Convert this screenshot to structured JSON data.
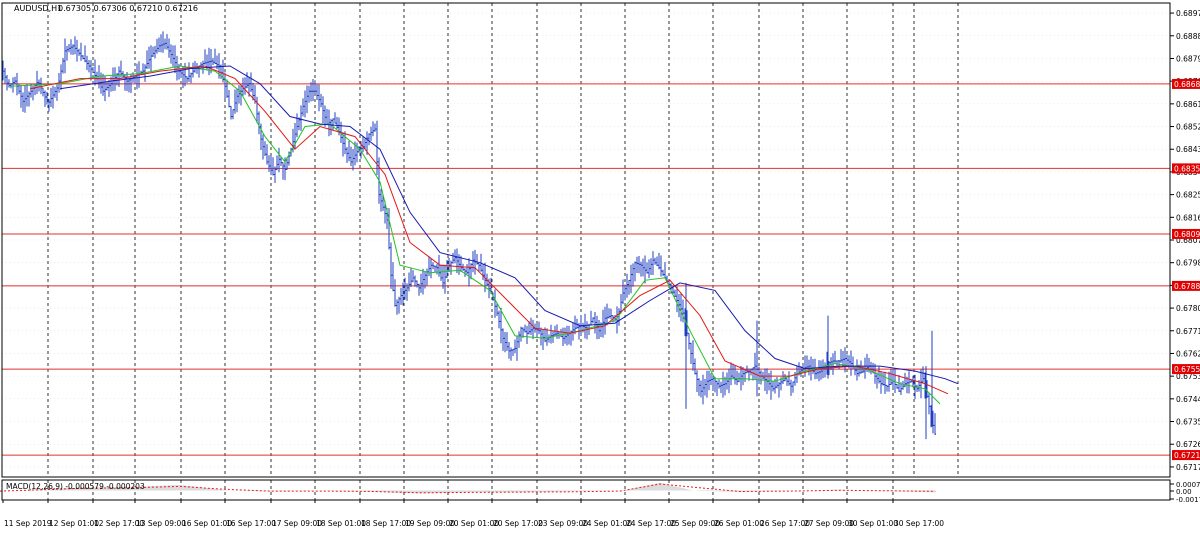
{
  "header": {
    "symbol_label": "AUDUSD,H1",
    "ohlc_text": "0.67305 0.67306 0.67210 0.67216"
  },
  "macd": {
    "label": "MACD(12,26,9) -0.000579 -0.000203",
    "ticks": [
      "0.000786",
      "0.00",
      "-0.00171"
    ]
  },
  "colors": {
    "background": "#ffffff",
    "price": "#1f3fbf",
    "ma_fast": "#22c322",
    "ma_mid": "#e01818",
    "ma_slow": "#1a1ab0",
    "level_line": "#e03030",
    "level_badge": "#e00000",
    "grid": "#000000",
    "macd_hist": "#b8b8b8",
    "macd_signal": "#e02020"
  },
  "chart_data": {
    "type": "candlestick",
    "ylim": [
      0.6713,
      0.6901
    ],
    "y_ticks": [
      "0.68970",
      "0.68880",
      "0.68790",
      "0.68700",
      "0.68610",
      "0.68520",
      "0.68430",
      "0.68340",
      "0.68250",
      "0.68160",
      "0.68070",
      "0.67980",
      "0.67890",
      "0.67800",
      "0.67710",
      "0.67620",
      "0.67530",
      "0.67440",
      "0.67350",
      "0.67260",
      "0.67170"
    ],
    "x_ticks": [
      "11 Sep 2019",
      "12 Sep 01:00",
      "12 Sep 17:00",
      "13 Sep 09:00",
      "16 Sep 01:00",
      "16 Sep 17:00",
      "17 Sep 09:00",
      "18 Sep 01:00",
      "18 Sep 17:00",
      "19 Sep 09:00",
      "20 Sep 01:00",
      "20 Sep 17:00",
      "23 Sep 09:00",
      "24 Sep 01:00",
      "24 Sep 17:00",
      "25 Sep 09:00",
      "26 Sep 01:00",
      "26 Sep 17:00",
      "27 Sep 09:00",
      "30 Sep 01:00",
      "30 Sep 17:00"
    ],
    "horizontal_levels": [
      "0.68689",
      "0.68354",
      "0.68094",
      "0.67888",
      "0.67558",
      "0.67217"
    ],
    "close_path": [
      [
        0,
        0.6874
      ],
      [
        5,
        0.6868
      ],
      [
        12,
        0.687
      ],
      [
        20,
        0.6862
      ],
      [
        28,
        0.6866
      ],
      [
        35,
        0.687
      ],
      [
        45,
        0.6861
      ],
      [
        55,
        0.6868
      ],
      [
        62,
        0.6882
      ],
      [
        70,
        0.6884
      ],
      [
        78,
        0.688
      ],
      [
        86,
        0.6876
      ],
      [
        94,
        0.6871
      ],
      [
        100,
        0.6866
      ],
      [
        108,
        0.6869
      ],
      [
        116,
        0.6874
      ],
      [
        124,
        0.687
      ],
      [
        132,
        0.6872
      ],
      [
        140,
        0.6874
      ],
      [
        148,
        0.688
      ],
      [
        156,
        0.6884
      ],
      [
        162,
        0.6885
      ],
      [
        170,
        0.6879
      ],
      [
        176,
        0.6874
      ],
      [
        184,
        0.6871
      ],
      [
        192,
        0.6875
      ],
      [
        200,
        0.6877
      ],
      [
        208,
        0.6878
      ],
      [
        216,
        0.6876
      ],
      [
        222,
        0.6868
      ],
      [
        228,
        0.6856
      ],
      [
        234,
        0.6864
      ],
      [
        240,
        0.6867
      ],
      [
        246,
        0.6869
      ],
      [
        252,
        0.6862
      ],
      [
        258,
        0.6847
      ],
      [
        264,
        0.6838
      ],
      [
        270,
        0.6833
      ],
      [
        276,
        0.6839
      ],
      [
        282,
        0.6835
      ],
      [
        288,
        0.6843
      ],
      [
        294,
        0.6852
      ],
      [
        300,
        0.686
      ],
      [
        306,
        0.6866
      ],
      [
        312,
        0.6866
      ],
      [
        318,
        0.6861
      ],
      [
        324,
        0.6853
      ],
      [
        330,
        0.6855
      ],
      [
        336,
        0.685
      ],
      [
        342,
        0.6843
      ],
      [
        348,
        0.6838
      ],
      [
        354,
        0.6842
      ],
      [
        360,
        0.6844
      ],
      [
        366,
        0.6849
      ],
      [
        372,
        0.6851
      ],
      [
        376,
        0.6825
      ],
      [
        380,
        0.682
      ],
      [
        384,
        0.6815
      ],
      [
        388,
        0.6793
      ],
      [
        392,
        0.6781
      ],
      [
        398,
        0.6785
      ],
      [
        404,
        0.6788
      ],
      [
        410,
        0.6792
      ],
      [
        416,
        0.6788
      ],
      [
        422,
        0.6793
      ],
      [
        428,
        0.6797
      ],
      [
        434,
        0.6796
      ],
      [
        440,
        0.679
      ],
      [
        446,
        0.6797
      ],
      [
        452,
        0.68
      ],
      [
        458,
        0.6796
      ],
      [
        464,
        0.6794
      ],
      [
        470,
        0.6799
      ],
      [
        476,
        0.6797
      ],
      [
        482,
        0.6791
      ],
      [
        488,
        0.6786
      ],
      [
        494,
        0.6778
      ],
      [
        500,
        0.6768
      ],
      [
        506,
        0.6763
      ],
      [
        512,
        0.6764
      ],
      [
        518,
        0.6772
      ],
      [
        524,
        0.677
      ],
      [
        530,
        0.6772
      ],
      [
        536,
        0.6771
      ],
      [
        542,
        0.6767
      ],
      [
        548,
        0.6769
      ],
      [
        554,
        0.677
      ],
      [
        560,
        0.6768
      ],
      [
        566,
        0.677
      ],
      [
        572,
        0.6772
      ],
      [
        578,
        0.6773
      ],
      [
        584,
        0.6772
      ],
      [
        590,
        0.6776
      ],
      [
        596,
        0.6771
      ],
      [
        602,
        0.6776
      ],
      [
        608,
        0.6777
      ],
      [
        614,
        0.6775
      ],
      [
        620,
        0.6786
      ],
      [
        626,
        0.6791
      ],
      [
        632,
        0.6798
      ],
      [
        638,
        0.6797
      ],
      [
        644,
        0.6794
      ],
      [
        650,
        0.6799
      ],
      [
        656,
        0.6796
      ],
      [
        662,
        0.6792
      ],
      [
        668,
        0.6788
      ],
      [
        674,
        0.6783
      ],
      [
        680,
        0.6778
      ],
      [
        686,
        0.6766
      ],
      [
        692,
        0.6754
      ],
      [
        698,
        0.6747
      ],
      [
        704,
        0.6751
      ],
      [
        710,
        0.6752
      ],
      [
        716,
        0.6749
      ],
      [
        722,
        0.675
      ],
      [
        728,
        0.6753
      ],
      [
        734,
        0.6751
      ],
      [
        740,
        0.6754
      ],
      [
        746,
        0.6755
      ],
      [
        752,
        0.6757
      ],
      [
        758,
        0.6753
      ],
      [
        764,
        0.6751
      ],
      [
        770,
        0.6748
      ],
      [
        776,
        0.675
      ],
      [
        782,
        0.6752
      ],
      [
        788,
        0.6749
      ],
      [
        794,
        0.6754
      ],
      [
        800,
        0.6756
      ],
      [
        806,
        0.6757
      ],
      [
        812,
        0.6754
      ],
      [
        818,
        0.6755
      ],
      [
        824,
        0.6758
      ],
      [
        830,
        0.6759
      ],
      [
        836,
        0.6759
      ],
      [
        842,
        0.676
      ],
      [
        848,
        0.6758
      ],
      [
        854,
        0.6754
      ],
      [
        860,
        0.6755
      ],
      [
        866,
        0.6757
      ],
      [
        872,
        0.6753
      ],
      [
        878,
        0.675
      ],
      [
        884,
        0.6749
      ],
      [
        890,
        0.6751
      ],
      [
        896,
        0.6747
      ],
      [
        902,
        0.675
      ],
      [
        908,
        0.6751
      ],
      [
        914,
        0.6748
      ],
      [
        920,
        0.6752
      ],
      [
        924,
        0.6745
      ],
      [
        928,
        0.6737
      ],
      [
        932,
        0.673
      ],
      [
        936,
        0.6722
      ]
    ],
    "ma_paths": [
      {
        "color_key": "ma_fast",
        "points": [
          [
            10,
            0.6868
          ],
          [
            60,
            0.6869
          ],
          [
            100,
            0.6872
          ],
          [
            140,
            0.6873
          ],
          [
            180,
            0.6876
          ],
          [
            215,
            0.6874
          ],
          [
            240,
            0.6866
          ],
          [
            265,
            0.6848
          ],
          [
            285,
            0.6838
          ],
          [
            305,
            0.6852
          ],
          [
            330,
            0.6853
          ],
          [
            360,
            0.6843
          ],
          [
            380,
            0.683
          ],
          [
            400,
            0.6797
          ],
          [
            430,
            0.6794
          ],
          [
            460,
            0.6795
          ],
          [
            490,
            0.6787
          ],
          [
            515,
            0.6769
          ],
          [
            545,
            0.6768
          ],
          [
            580,
            0.6771
          ],
          [
            615,
            0.6775
          ],
          [
            645,
            0.6791
          ],
          [
            665,
            0.6792
          ],
          [
            690,
            0.6771
          ],
          [
            715,
            0.6752
          ],
          [
            745,
            0.6752
          ],
          [
            775,
            0.6751
          ],
          [
            805,
            0.6755
          ],
          [
            835,
            0.6758
          ],
          [
            865,
            0.6756
          ],
          [
            900,
            0.675
          ],
          [
            925,
            0.6748
          ],
          [
            940,
            0.6742
          ]
        ]
      },
      {
        "color_key": "ma_mid",
        "points": [
          [
            30,
            0.6867
          ],
          [
            80,
            0.6871
          ],
          [
            120,
            0.6871
          ],
          [
            160,
            0.6874
          ],
          [
            205,
            0.6876
          ],
          [
            235,
            0.6871
          ],
          [
            265,
            0.6858
          ],
          [
            295,
            0.6843
          ],
          [
            320,
            0.6852
          ],
          [
            355,
            0.6848
          ],
          [
            385,
            0.6833
          ],
          [
            410,
            0.6806
          ],
          [
            440,
            0.6797
          ],
          [
            475,
            0.6796
          ],
          [
            505,
            0.6784
          ],
          [
            535,
            0.6772
          ],
          [
            570,
            0.677
          ],
          [
            605,
            0.6773
          ],
          [
            640,
            0.6785
          ],
          [
            670,
            0.6791
          ],
          [
            700,
            0.6777
          ],
          [
            725,
            0.6759
          ],
          [
            760,
            0.6753
          ],
          [
            790,
            0.6753
          ],
          [
            820,
            0.6756
          ],
          [
            855,
            0.6757
          ],
          [
            890,
            0.6754
          ],
          [
            925,
            0.675
          ],
          [
            948,
            0.6746
          ]
        ]
      },
      {
        "color_key": "ma_slow",
        "points": [
          [
            60,
            0.6867
          ],
          [
            110,
            0.687
          ],
          [
            150,
            0.6872
          ],
          [
            190,
            0.6875
          ],
          [
            230,
            0.6876
          ],
          [
            260,
            0.6869
          ],
          [
            290,
            0.6856
          ],
          [
            320,
            0.6853
          ],
          [
            350,
            0.6852
          ],
          [
            380,
            0.6843
          ],
          [
            410,
            0.6818
          ],
          [
            440,
            0.6802
          ],
          [
            480,
            0.6798
          ],
          [
            515,
            0.6792
          ],
          [
            545,
            0.6779
          ],
          [
            580,
            0.6773
          ],
          [
            615,
            0.6774
          ],
          [
            650,
            0.6783
          ],
          [
            680,
            0.679
          ],
          [
            715,
            0.6787
          ],
          [
            745,
            0.6771
          ],
          [
            775,
            0.676
          ],
          [
            805,
            0.6756
          ],
          [
            840,
            0.6757
          ],
          [
            880,
            0.6757
          ],
          [
            915,
            0.6755
          ],
          [
            945,
            0.6752
          ],
          [
            958,
            0.675
          ]
        ]
      }
    ],
    "macd_signal_path": [
      [
        0,
        -0.00018
      ],
      [
        40,
        6e-05
      ],
      [
        80,
        0.00018
      ],
      [
        130,
        0.00022
      ],
      [
        180,
        0.00034
      ],
      [
        225,
        0.0001
      ],
      [
        270,
        -0.00019
      ],
      [
        320,
        -0.0002
      ],
      [
        370,
        -0.00029
      ],
      [
        420,
        -0.00074
      ],
      [
        470,
        -0.00061
      ],
      [
        520,
        -0.00051
      ],
      [
        570,
        -0.00041
      ],
      [
        620,
        -0.00018
      ],
      [
        660,
        0.00054
      ],
      [
        700,
        0.00022
      ],
      [
        740,
        -0.00033
      ],
      [
        790,
        -0.00018
      ],
      [
        840,
        2e-05
      ],
      [
        890,
        -0.0001
      ],
      [
        935,
        -0.00026
      ]
    ],
    "macd_hist_path": [
      [
        0,
        -0.00012
      ],
      [
        40,
        0.00013
      ],
      [
        80,
        0.00024
      ],
      [
        130,
        0.00029
      ],
      [
        180,
        0.00046
      ],
      [
        225,
        4e-05
      ],
      [
        270,
        -0.00032
      ],
      [
        320,
        -0.00012
      ],
      [
        370,
        -0.00038
      ],
      [
        420,
        -0.00096
      ],
      [
        470,
        -0.00049
      ],
      [
        520,
        -0.00056
      ],
      [
        570,
        -0.00028
      ],
      [
        620,
        -6e-05
      ],
      [
        660,
        0.00064
      ],
      [
        700,
        -0.00014
      ],
      [
        740,
        -0.00046
      ],
      [
        790,
        -6e-05
      ],
      [
        840,
        8e-05
      ],
      [
        890,
        -0.00022
      ],
      [
        935,
        -0.00058
      ]
    ]
  }
}
